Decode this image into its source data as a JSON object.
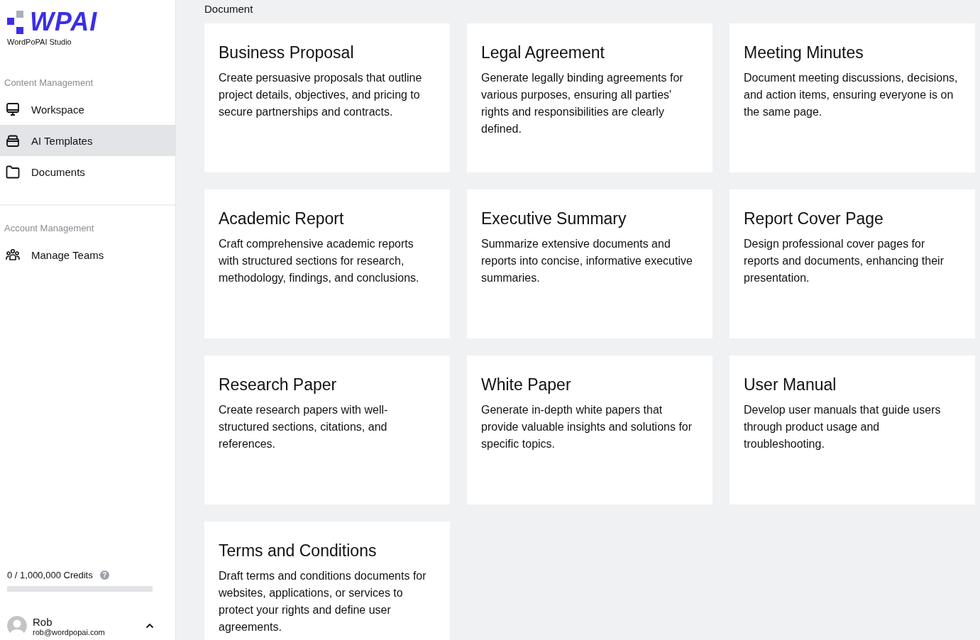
{
  "sidebar": {
    "logo": "WPAI",
    "studio": "WordPoPAI Studio",
    "sections": [
      {
        "title": "Content Management",
        "items": [
          {
            "label": "Workspace",
            "kind": "monitor",
            "selected": false
          },
          {
            "label": "AI Templates",
            "kind": "stack",
            "selected": true
          },
          {
            "label": "Documents",
            "kind": "folder",
            "selected": false
          }
        ]
      },
      {
        "title": "Account Management",
        "items": [
          {
            "label": "Manage Teams",
            "kind": "team",
            "selected": false
          }
        ]
      }
    ],
    "credits": {
      "label": "0 / 1,000,000 Credits",
      "help": "?",
      "level": 0
    },
    "user": {
      "name": "Rob",
      "email": "rob@wordpopai.com"
    }
  },
  "main": {
    "heading": "Document",
    "cards": [
      {
        "title": "Business Proposal",
        "description": "Create persuasive proposals that outline project details, objectives, and pricing to secure partnerships and contracts."
      },
      {
        "title": "Legal Agreement",
        "description": "Generate legally binding agreements for various purposes, ensuring all parties' rights and responsibilities are clearly defined."
      },
      {
        "title": "Meeting Minutes",
        "description": "Document meeting discussions, decisions, and action items, ensuring everyone is on the same page."
      },
      {
        "title": "Academic Report",
        "description": "Craft comprehensive academic reports with structured sections for research, methodology, findings, and conclusions."
      },
      {
        "title": "Executive Summary",
        "description": "Summarize extensive documents and reports into concise, informative executive summaries."
      },
      {
        "title": "Report Cover Page",
        "description": "Design professional cover pages for reports and documents, enhancing their presentation."
      },
      {
        "title": "Research Paper",
        "description": "Create research papers with well-structured sections, citations, and references."
      },
      {
        "title": "White Paper",
        "description": "Generate in-depth white papers that provide valuable insights and solutions for specific topics."
      },
      {
        "title": "User Manual",
        "description": "Develop user manuals that guide users through product usage and troubleshooting."
      },
      {
        "title": "Terms and Conditions",
        "description": "Draft terms and conditions documents for websites, applications, or services to protect your rights and define user agreements."
      }
    ]
  }
}
